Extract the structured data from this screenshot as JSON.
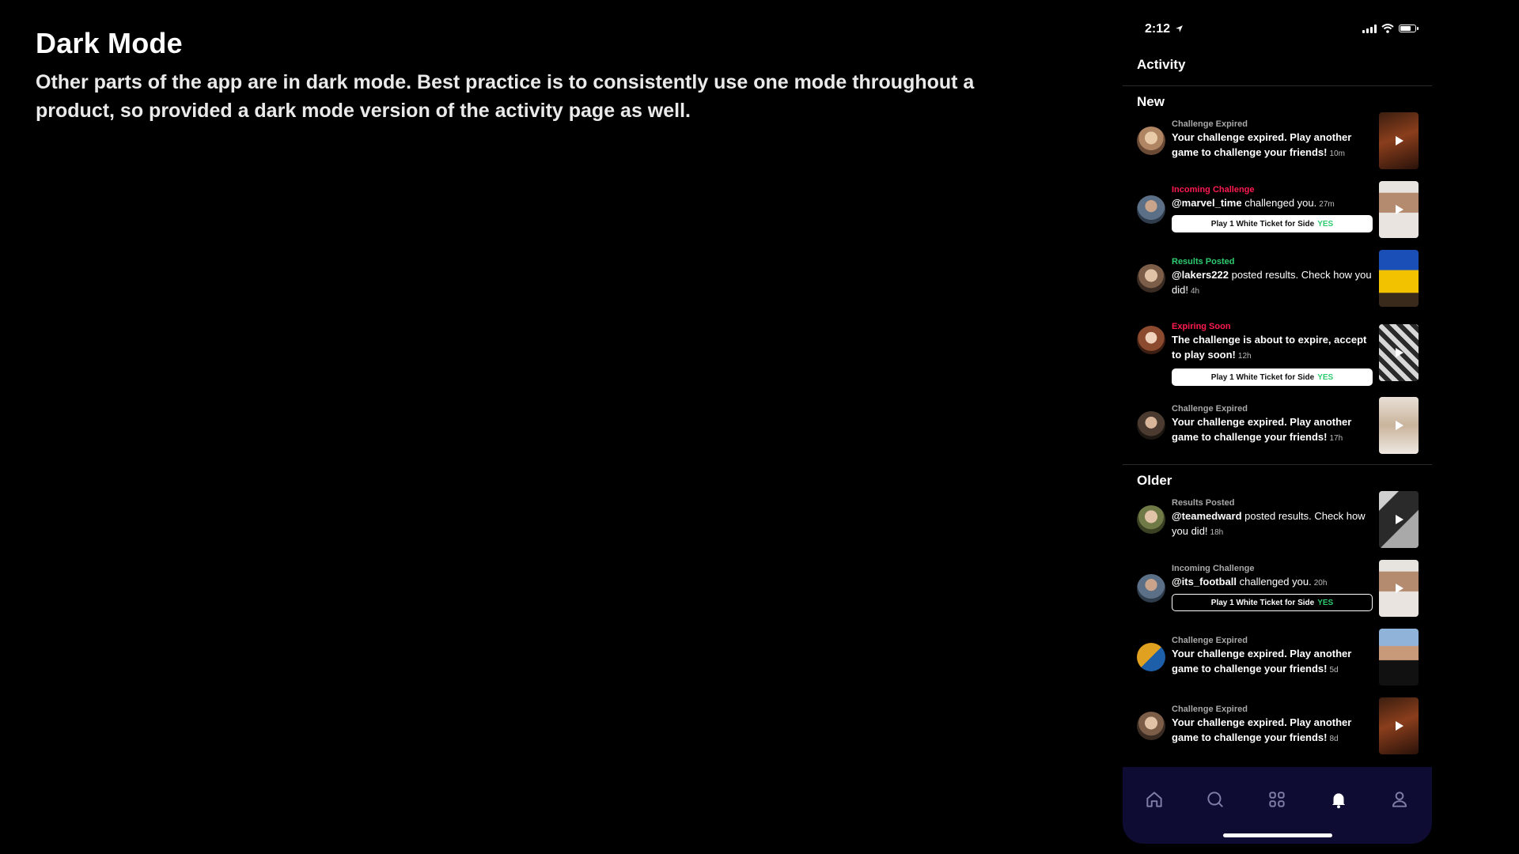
{
  "annotation": {
    "title": "Dark Mode",
    "body": "Other parts of the app are in dark mode. Best practice is to consistently use one mode throughout a product, so provided a dark mode version of the activity page as well."
  },
  "status_bar": {
    "time": "2:12"
  },
  "header": {
    "title": "Activity"
  },
  "sections": {
    "new": "New",
    "older": "Older"
  },
  "colors": {
    "background": "#000000",
    "tabbar": "#0f0c33",
    "incoming_challenge": "#ff1a4f",
    "results_posted": "#2ecc71",
    "expiring_soon": "#ff1a4f",
    "muted_category": "#a8a8a8",
    "yes": "#2ecc71"
  },
  "items": [
    {
      "category": "Challenge Expired",
      "user": "",
      "text": "Your challenge expired. Play another game to challenge your friends!",
      "time": "10m",
      "thumb": "play"
    },
    {
      "category": "Incoming Challenge",
      "user": "@marvel_time",
      "text": "challenged you.",
      "time": "27m",
      "ticket": "Play 1 White Ticket for Side",
      "ticket_yes": "YES",
      "thumb": "play"
    },
    {
      "category": "Results Posted",
      "user": "@lakers222",
      "text": "posted results. Check how you did!",
      "time": "4h",
      "thumb": "none"
    },
    {
      "category": "Expiring Soon",
      "user": "",
      "text": "The challenge is about to expire, accept to play soon!",
      "time": "12h",
      "ticket": "Play 1 White Ticket for Side",
      "ticket_yes": "YES",
      "thumb": "play"
    },
    {
      "category": "Challenge Expired",
      "user": "",
      "text": "Your challenge expired. Play another game to challenge your friends!",
      "time": "17h",
      "thumb": "play"
    },
    {
      "category": "Results Posted",
      "user": "@teamedward",
      "text": "posted results. Check how you did!",
      "time": "18h",
      "thumb": "play"
    },
    {
      "category": "Incoming Challenge",
      "user": "@its_football",
      "text": "challenged you.",
      "time": "20h",
      "ticket": "Play 1 White Ticket for Side",
      "ticket_yes": "YES",
      "thumb": "play"
    },
    {
      "category": "Challenge Expired",
      "user": "",
      "text": "Your challenge expired. Play another game to challenge your friends!",
      "time": "5d",
      "thumb": "none"
    },
    {
      "category": "Challenge Expired",
      "user": "",
      "text": "Your challenge expired. Play another game to challenge your friends!",
      "time": "8d",
      "thumb": "play"
    }
  ],
  "tabbar": {
    "icons": [
      "home-icon",
      "search-icon",
      "grid-icon",
      "bell-icon",
      "profile-icon"
    ],
    "active": "bell-icon"
  }
}
